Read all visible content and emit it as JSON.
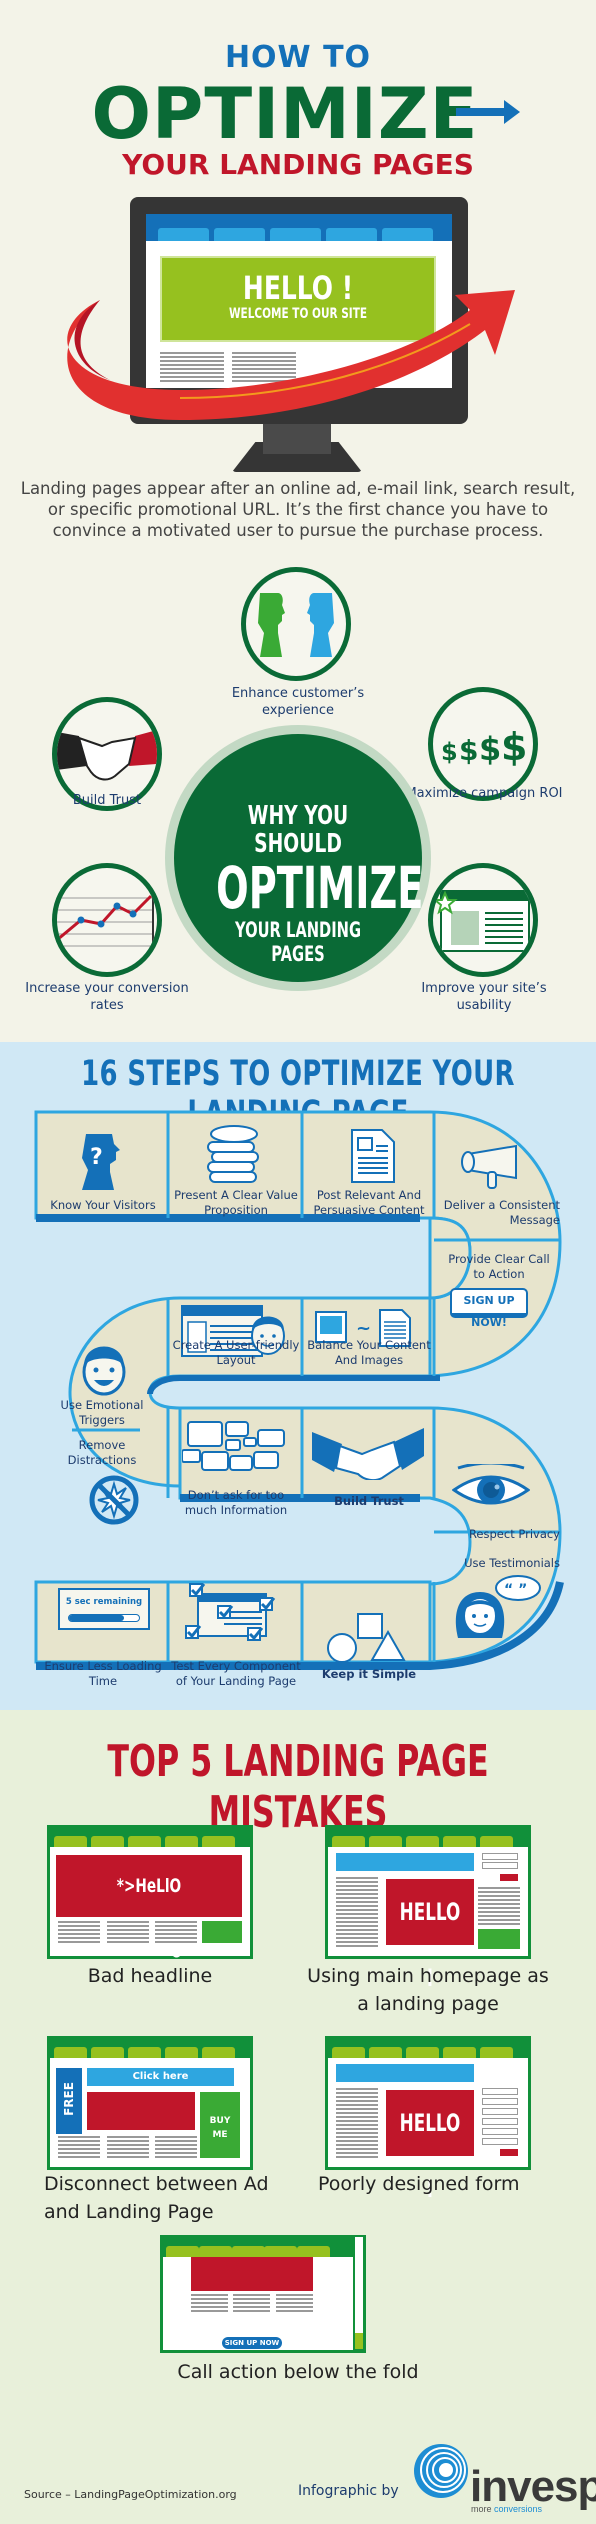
{
  "header": {
    "line1": "HOW TO",
    "line2": "OPTIMIZE",
    "line3": "YOUR LANDING PAGES"
  },
  "monitor": {
    "hello": "HELLO !",
    "welcome": "WELCOME TO OUR SITE"
  },
  "intro": {
    "text": "Landing pages appear after an online ad, e-mail link, search result, or specific promotional URL. It’s the first chance you have to convince a motivated user to pursue the purchase process."
  },
  "why": {
    "line1": "WHY YOU SHOULD",
    "line2": "OPTIMIZE",
    "line3": "YOUR LANDING PAGES",
    "benefits": [
      {
        "label": "Enhance customer’s experience",
        "icon": "two-heads-icon"
      },
      {
        "label": "Build Trust",
        "icon": "handshake-icon"
      },
      {
        "label": "Maximize campaign ROI",
        "icon": "dollar-signs-icon"
      },
      {
        "label": "Increase your conversion rates",
        "icon": "line-chart-icon"
      },
      {
        "label": "Improve your site’s usability",
        "icon": "webpage-star-icon"
      }
    ]
  },
  "steps": {
    "title": "16 STEPS TO OPTIMIZE YOUR LANDING PAGE",
    "items": [
      {
        "label": "Know Your Visitors",
        "icon": "head-question-icon"
      },
      {
        "label": "Present A Clear Value Proposition",
        "icon": "coins-stack-icon"
      },
      {
        "label": "Post Relevant And Persuasive Content",
        "icon": "document-icon"
      },
      {
        "label": "Deliver a Consistent Message",
        "icon": "megaphone-icon"
      },
      {
        "label": "Provide Clear Call to Action",
        "icon": "signup-button-icon",
        "button": "SIGN UP NOW!"
      },
      {
        "label": "Balance Your Content And Images",
        "icon": "image-document-icon"
      },
      {
        "label": "Create A User-friendly Layout",
        "icon": "layout-face-icon"
      },
      {
        "label": "Use Emotional Triggers",
        "icon": "smiling-face-icon"
      },
      {
        "label": "Remove Distractions",
        "icon": "no-distraction-icon"
      },
      {
        "label": "Don’t ask for too much Information",
        "icon": "speech-bubbles-icon"
      },
      {
        "label": "Build Trust",
        "icon": "handshake-icon"
      },
      {
        "label": "Respect Privacy",
        "icon": "eye-icon"
      },
      {
        "label": "Use Testimonials",
        "icon": "woman-quote-icon"
      },
      {
        "label": "Keep it Simple",
        "icon": "shapes-icon"
      },
      {
        "label": "Test Every Component of Your Landing Page",
        "icon": "checklist-layout-icon"
      },
      {
        "label": "Ensure Less Loading Time",
        "icon": "loading-bar-icon",
        "loading_text": "5 sec remaining",
        "loading_progress": 0.78
      }
    ]
  },
  "mistakes": {
    "title": "TOP 5 LANDING PAGE MISTAKES",
    "items": [
      {
        "label": "Bad headline",
        "banner": "*>HeLlO WoRlD#@*"
      },
      {
        "label": "Using main homepage as a landing page",
        "banner": "HELLO !"
      },
      {
        "label": "Disconnect between Ad and Landing Page",
        "free": "FREE",
        "click": "Click here",
        "buy": "BUY ME"
      },
      {
        "label": "Poorly designed form",
        "banner": "HELLO !"
      },
      {
        "label": "Call action below the fold",
        "cta": "SIGN UP NOW"
      }
    ]
  },
  "footer": {
    "source": "Source – LandingPageOptimization.org",
    "by": "Infographic by",
    "logo": "invesp",
    "tagline_a": "more ",
    "tagline_b": "conversions"
  },
  "colors": {
    "green": "#0a6a36",
    "blue": "#1470b8",
    "red": "#c0162a",
    "lime": "#96c11f",
    "cream": "#f3f3e8",
    "sky": "#d0e8f5",
    "mint": "#e8f0da"
  }
}
